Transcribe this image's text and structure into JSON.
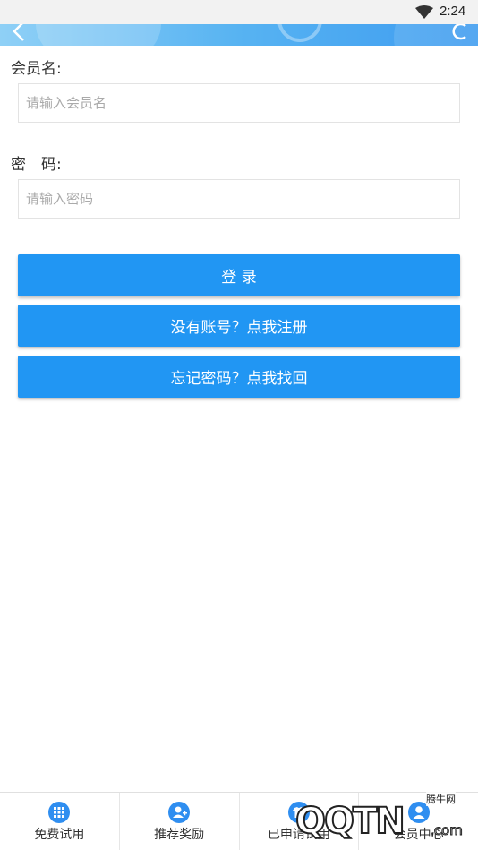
{
  "status_bar": {
    "time": "2:24"
  },
  "form": {
    "username_label": "会员名:",
    "username_placeholder": "请输入会员名",
    "password_label": "密　码:",
    "password_placeholder": "请输入密码"
  },
  "buttons": {
    "login": "登 录",
    "register": "没有账号？点我注册",
    "forgot": "忘记密码？点我找回"
  },
  "bottom_nav": {
    "items": [
      {
        "label": "免费试用",
        "icon": "grid-icon"
      },
      {
        "label": "推荐奖励",
        "icon": "user-add-icon"
      },
      {
        "label": "已申请试用",
        "icon": "shirt-icon"
      },
      {
        "label": "会员中心",
        "icon": "user-icon"
      }
    ]
  },
  "watermark": {
    "logo": "QQTN",
    "site": "腾牛网",
    "suffix": ".com"
  },
  "colors": {
    "primary": "#2196f3",
    "header_gradient_start": "#8fd0f6",
    "header_gradient_end": "#3e9cf0"
  }
}
